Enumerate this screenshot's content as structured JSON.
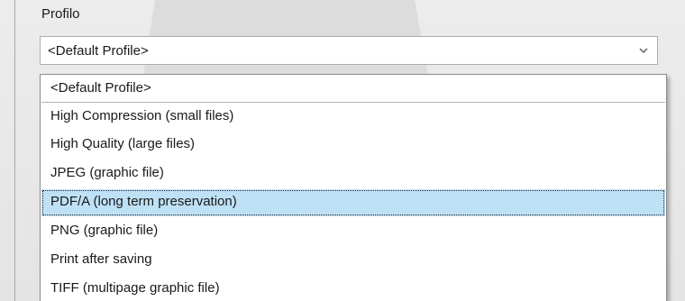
{
  "label": "Profilo",
  "combo": {
    "value": "<Default Profile>",
    "arrow_icon": "chevron-down-icon"
  },
  "dropdown": {
    "selected_index": 4,
    "options": [
      "<Default Profile>",
      "High Compression (small files)",
      "High Quality (large files)",
      "JPEG (graphic file)",
      "PDF/A (long term preservation)",
      "PNG (graphic file)",
      "Print after saving",
      "TIFF (multipage graphic file)"
    ]
  },
  "colors": {
    "selected_bg": "#bfe1f6",
    "border": "#adadad",
    "background": "#e6e6e6"
  }
}
